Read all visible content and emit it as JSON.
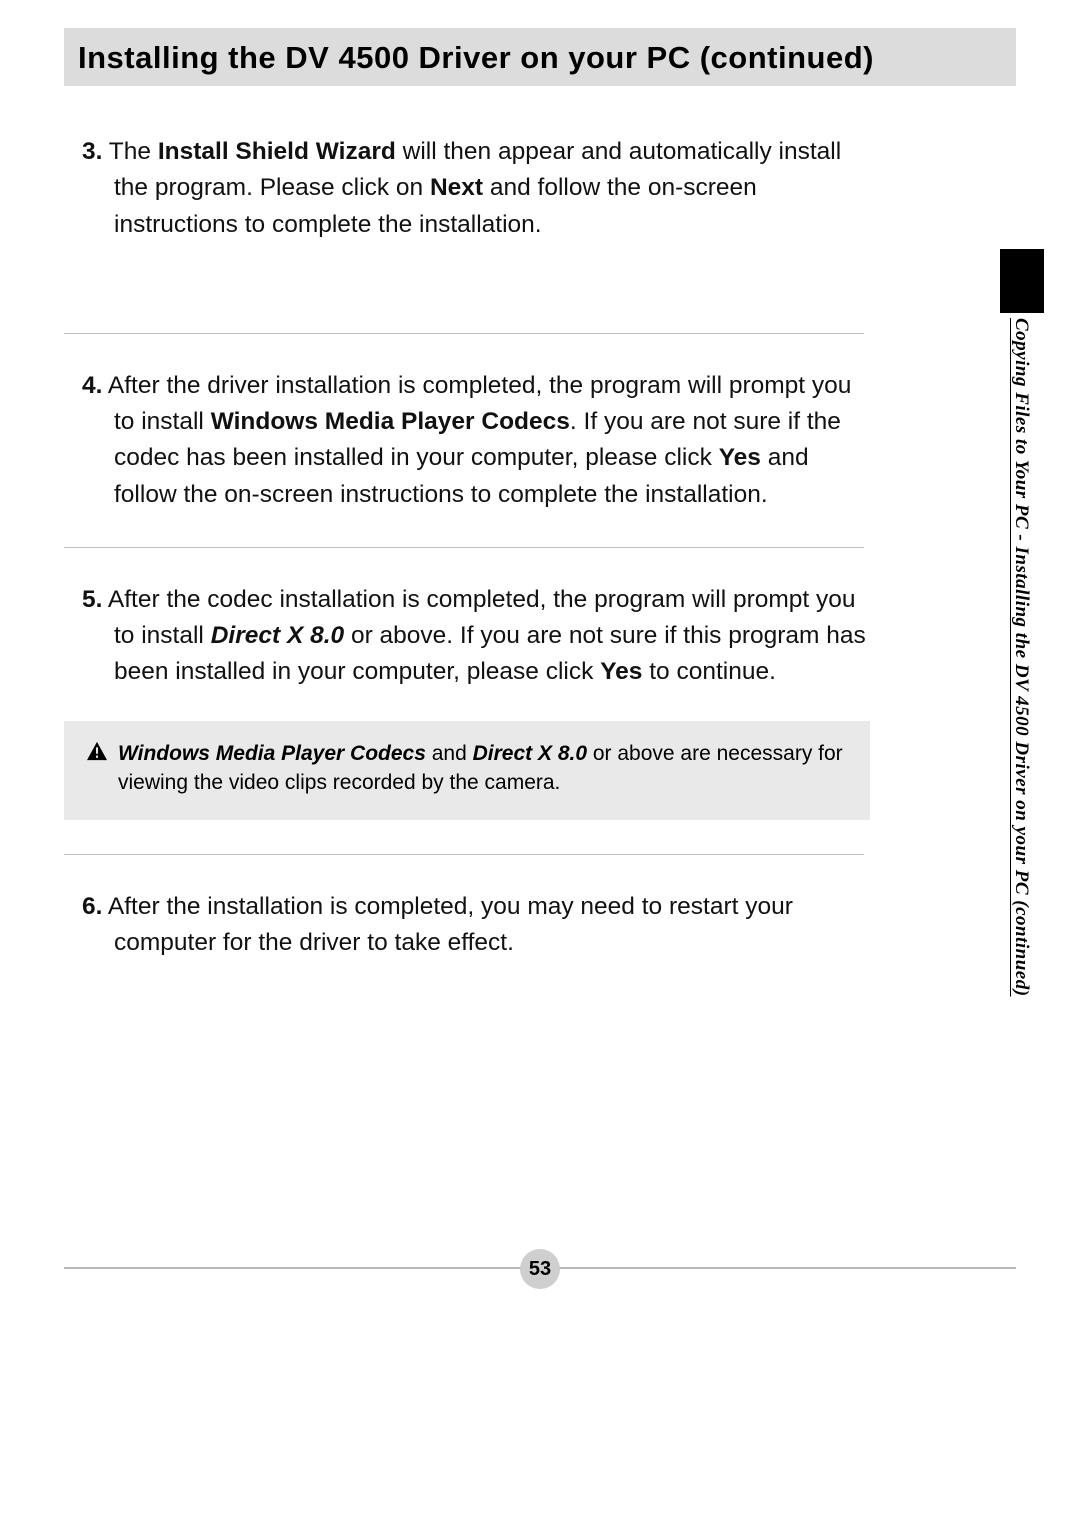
{
  "title": "Installing the DV 4500 Driver on your PC (continued)",
  "side_label": "Copying Files to Your PC - Installing the DV 4500 Driver on your PC (continued)",
  "page_number": "53",
  "steps": {
    "s3": {
      "num": "3.",
      "t1": " The ",
      "b1": "Install Shield Wizard",
      "t2": " will then appear and automatically install the program. Please click on ",
      "b2": "Next",
      "t3": " and follow the on-screen instructions to complete the installation."
    },
    "s4": {
      "num": "4.",
      "t1": " After the driver installation is completed, the program will prompt you to install ",
      "b1": "Windows Media Player Codecs",
      "t2": ". If you are not sure if the codec has been installed in your computer, please click ",
      "b2": "Yes",
      "t3": " and follow the on-screen instructions to complete the installation."
    },
    "s5": {
      "num": "5.",
      "t1": " After the codec installation is completed, the program will prompt you to install ",
      "bi1": "Direct X 8.0",
      "t2": " or above. If you are not sure if this program has been installed in your computer, please click ",
      "b1": "Yes",
      "t3": " to continue."
    },
    "s6": {
      "num": "6.",
      "t1": " After the installation is completed, you may need to restart your computer for the driver to take effect."
    }
  },
  "note": {
    "bi1": "Windows Media Player Codecs",
    "t1": " and ",
    "bi2": "Direct X 8.0",
    "t2": " or above are necessary for viewing the video clips recorded by the camera."
  }
}
